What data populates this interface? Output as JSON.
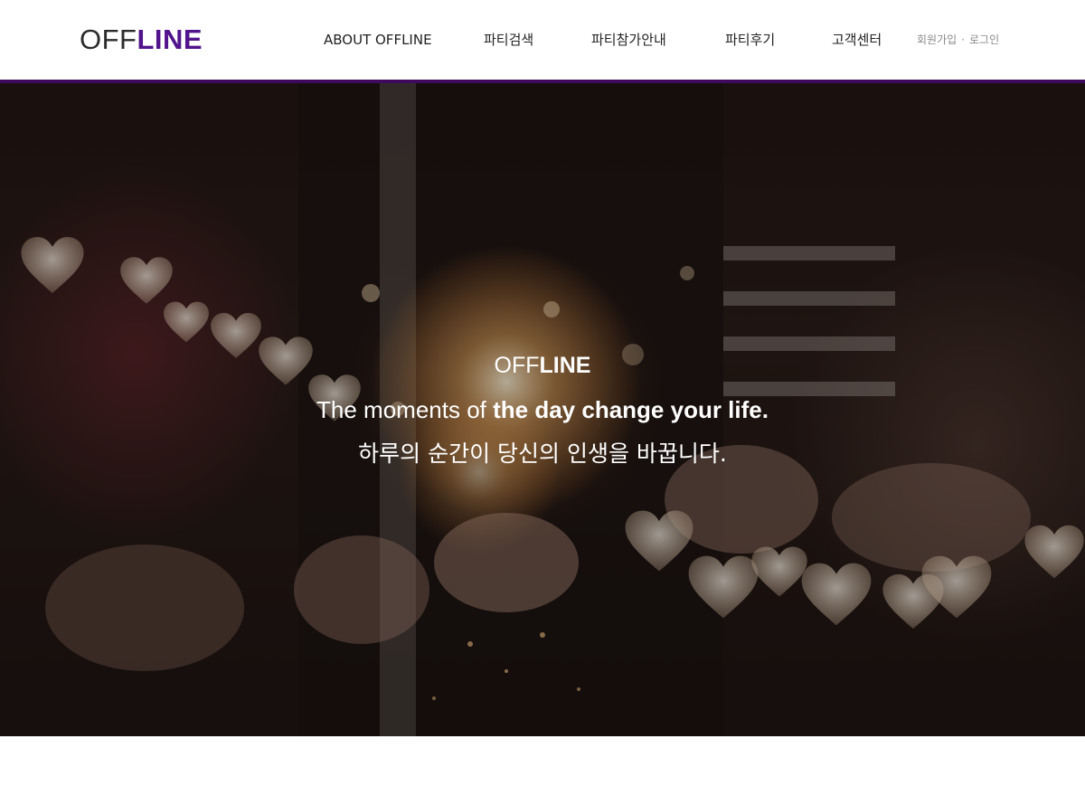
{
  "header": {
    "logo": {
      "part1": "OFF",
      "part2": "LINE"
    },
    "nav": [
      {
        "label": "ABOUT OFFLINE"
      },
      {
        "label": "파티검색"
      },
      {
        "label": "파티참가안내"
      },
      {
        "label": "파티후기"
      },
      {
        "label": "고객센터"
      }
    ],
    "auth": {
      "signup": "회원가입",
      "separator": "·",
      "login": "로그인"
    }
  },
  "hero": {
    "brand": {
      "part1": "OFF",
      "part2": "LINE"
    },
    "tagline": {
      "normal": "The moments of ",
      "bold": "the day change your life."
    },
    "korean": "하루의 순간이 당신의 인생을 바꿉니다."
  },
  "colors": {
    "brand_purple": "#52148c",
    "accent_bar": "#3f0a5e",
    "nav_text": "#222222",
    "auth_text": "#8a8a8a"
  }
}
